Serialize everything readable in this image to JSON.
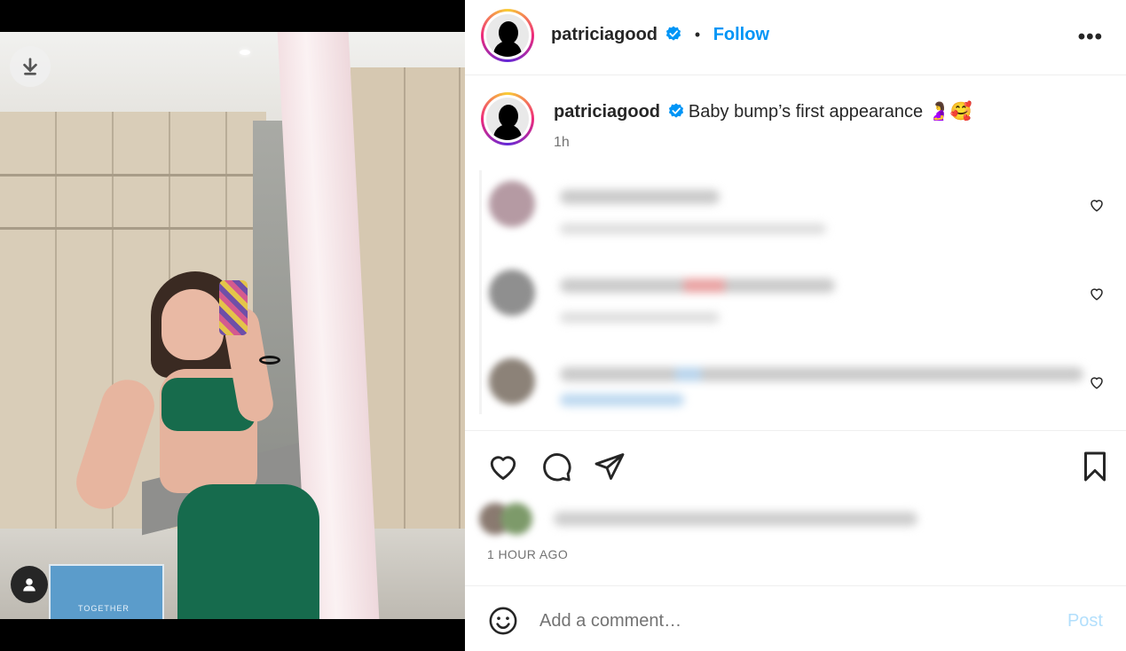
{
  "post": {
    "author": "patriciagood",
    "follow_label": "Follow",
    "dot": "•",
    "more_label": "•••",
    "caption": "Baby bump’s first appearance 🤰🥰",
    "caption_time": "1h",
    "time_ago": "1 HOUR AGO"
  },
  "photo": {
    "sign_text": "TOGETHER"
  },
  "comment_form": {
    "placeholder": "Add a comment…",
    "post_label": "Post"
  },
  "colors": {
    "accent": "#0095f6",
    "verified": "#0095f6",
    "post_disabled": "#b2dffc"
  },
  "icons": [
    "download-icon",
    "user-tag-icon",
    "verified-icon",
    "more-icon",
    "heart-icon",
    "comment-icon",
    "share-icon",
    "bookmark-icon",
    "emoji-icon"
  ]
}
